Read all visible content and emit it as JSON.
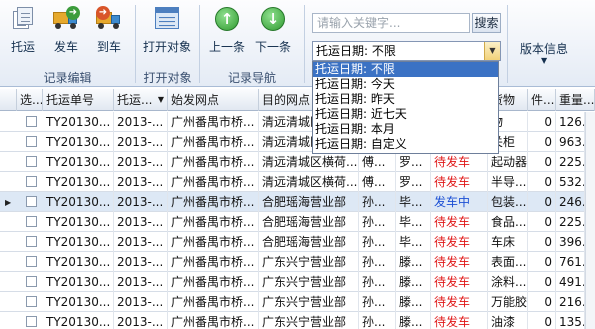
{
  "toolbar": {
    "groups": [
      {
        "label": "记录编辑"
      },
      {
        "label": "打开对象"
      },
      {
        "label": "记录导航"
      }
    ],
    "buttons": [
      {
        "label": "托运",
        "icon": "consign-docs-icon"
      },
      {
        "label": "发车",
        "icon": "depart-truck-icon"
      },
      {
        "label": "到车",
        "icon": "arrive-truck-icon"
      },
      {
        "label": "打开对象",
        "icon": "open-object-icon"
      },
      {
        "label": "上一条",
        "icon": "arrow-up-circle-icon"
      },
      {
        "label": "下一条",
        "icon": "arrow-down-circle-icon"
      }
    ],
    "search_placeholder": "请输入关键字...",
    "search_button": "搜索",
    "filter_value": "托运日期: 不限",
    "filter_options": [
      "托运日期: 不限",
      "托运日期: 今天",
      "托运日期: 昨天",
      "托运日期: 近七天",
      "托运日期: 本月",
      "托运日期: 自定义"
    ],
    "version_label": "版本信息"
  },
  "grid": {
    "columns": [
      "选...",
      "托运单号",
      "托运...",
      "始发网点",
      "目的网点",
      "",
      "",
      "",
      "货物",
      "件...",
      "重量..."
    ],
    "sort_indicator": "▼",
    "status_colors": {
      "pending": "#e01818",
      "departing": "#1c4fd4"
    },
    "rows": [
      {
        "no": "TY20130...",
        "date": "2013-...",
        "from": "广州番禺市桥...",
        "to": "清远清城区横荷...",
        "c5": "",
        "c6": "",
        "status": "",
        "goods": "物",
        "pieces": "0",
        "weight": "126..."
      },
      {
        "no": "TY20130...",
        "date": "2013-...",
        "from": "广州番禺市桥...",
        "to": "清远清城区横荷...",
        "c5": "",
        "c6": "",
        "status": "",
        "goods": "关柜",
        "pieces": "0",
        "weight": "963..."
      },
      {
        "no": "TY20130...",
        "date": "2013-...",
        "from": "广州番禺市桥...",
        "to": "清远清城区横荷...",
        "c5": "傅...",
        "c6": "罗...",
        "status": "待发车",
        "goods": "起动器",
        "pieces": "0",
        "weight": "225..."
      },
      {
        "no": "TY20130...",
        "date": "2013-...",
        "from": "广州番禺市桥...",
        "to": "清远清城区横荷...",
        "c5": "傅...",
        "c6": "罗...",
        "status": "待发车",
        "goods": "半导...",
        "pieces": "0",
        "weight": "532..."
      },
      {
        "no": "TY20130...",
        "date": "2013-...",
        "from": "广州番禺市桥...",
        "to": "合肥瑶海营业部",
        "c5": "孙...",
        "c6": "毕...",
        "status": "发车中",
        "goods": "包装...",
        "pieces": "0",
        "weight": "246..."
      },
      {
        "no": "TY20130...",
        "date": "2013-...",
        "from": "广州番禺市桥...",
        "to": "合肥瑶海营业部",
        "c5": "孙...",
        "c6": "毕...",
        "status": "待发车",
        "goods": "食品...",
        "pieces": "0",
        "weight": "225..."
      },
      {
        "no": "TY20130...",
        "date": "2013-...",
        "from": "广州番禺市桥...",
        "to": "合肥瑶海营业部",
        "c5": "孙...",
        "c6": "毕...",
        "status": "待发车",
        "goods": "车床",
        "pieces": "0",
        "weight": "396..."
      },
      {
        "no": "TY20130...",
        "date": "2013-...",
        "from": "广州番禺市桥...",
        "to": "广东兴宁营业部",
        "c5": "孙...",
        "c6": "滕...",
        "status": "待发车",
        "goods": "表面...",
        "pieces": "0",
        "weight": "761..."
      },
      {
        "no": "TY20130...",
        "date": "2013-...",
        "from": "广州番禺市桥...",
        "to": "广东兴宁营业部",
        "c5": "孙...",
        "c6": "滕...",
        "status": "待发车",
        "goods": "涂料...",
        "pieces": "0",
        "weight": "491..."
      },
      {
        "no": "TY20130...",
        "date": "2013-...",
        "from": "广州番禺市桥...",
        "to": "广东兴宁营业部",
        "c5": "孙...",
        "c6": "滕...",
        "status": "待发车",
        "goods": "万能胶",
        "pieces": "0",
        "weight": "216..."
      },
      {
        "no": "TY20130...",
        "date": "2013-...",
        "from": "广州番禺市桥...",
        "to": "广东兴宁营业部",
        "c5": "孙...",
        "c6": "滕...",
        "status": "待发车",
        "goods": "油漆",
        "pieces": "0",
        "weight": "135..."
      }
    ]
  }
}
